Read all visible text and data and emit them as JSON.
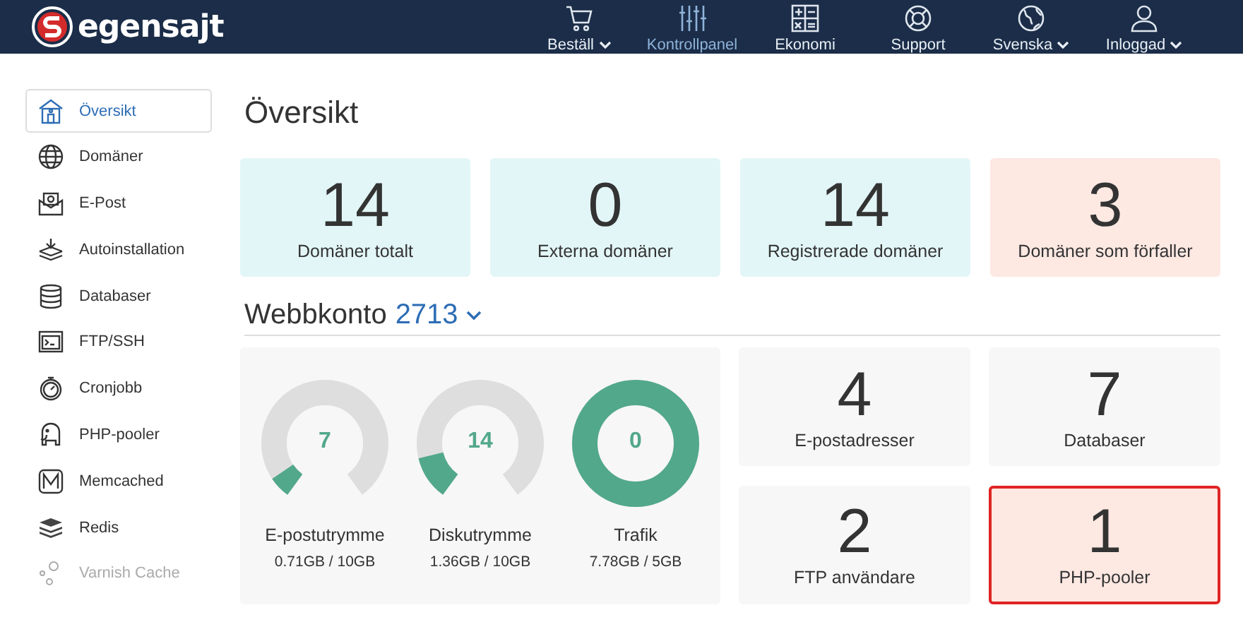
{
  "header": {
    "logo": "egensajt",
    "nav": [
      {
        "label": "Beställ",
        "dropdown": true,
        "selected": false
      },
      {
        "label": "Kontrollpanel",
        "dropdown": false,
        "selected": true
      },
      {
        "label": "Ekonomi",
        "dropdown": false,
        "selected": false
      },
      {
        "label": "Support",
        "dropdown": false,
        "selected": false
      },
      {
        "label": "Svenska",
        "dropdown": true,
        "selected": false
      },
      {
        "label": "Inloggad",
        "dropdown": true,
        "selected": false
      }
    ]
  },
  "sidebar": {
    "items": [
      {
        "label": "Översikt",
        "selected": true,
        "disabled": false
      },
      {
        "label": "Domäner",
        "selected": false,
        "disabled": false
      },
      {
        "label": "E-Post",
        "selected": false,
        "disabled": false
      },
      {
        "label": "Autoinstallation",
        "selected": false,
        "disabled": false
      },
      {
        "label": "Databaser",
        "selected": false,
        "disabled": false
      },
      {
        "label": "FTP/SSH",
        "selected": false,
        "disabled": false
      },
      {
        "label": "Cronjobb",
        "selected": false,
        "disabled": false
      },
      {
        "label": "PHP-pooler",
        "selected": false,
        "disabled": false
      },
      {
        "label": "Memcached",
        "selected": false,
        "disabled": false
      },
      {
        "label": "Redis",
        "selected": false,
        "disabled": false
      },
      {
        "label": "Varnish Cache",
        "selected": false,
        "disabled": true
      }
    ]
  },
  "page_title": "Översikt",
  "stats": [
    {
      "value": "14",
      "label": "Domäner totalt",
      "alert": false
    },
    {
      "value": "0",
      "label": "Externa domäner",
      "alert": false
    },
    {
      "value": "14",
      "label": "Registrerade domäner",
      "alert": false
    },
    {
      "value": "3",
      "label": "Domäner som förfaller",
      "alert": true
    }
  ],
  "account": {
    "label": "Webbkonto",
    "number": "2713"
  },
  "gauges": [
    {
      "value": "7",
      "label": "E-postutrymme",
      "usage": "0.71GB / 10GB",
      "level": 0.07
    },
    {
      "value": "14",
      "label": "Diskutrymme",
      "usage": "1.36GB / 10GB",
      "level": 0.14
    },
    {
      "value": "0",
      "label": "Trafik",
      "usage": "7.78GB / 5GB",
      "level": 1
    }
  ],
  "counters": [
    {
      "value": "4",
      "label": "E-postadresser",
      "alert": false,
      "highlighted": false
    },
    {
      "value": "7",
      "label": "Databaser",
      "alert": false,
      "highlighted": false
    },
    {
      "value": "2",
      "label": "FTP användare",
      "alert": false,
      "highlighted": false
    },
    {
      "value": "1",
      "label": "PHP-pooler",
      "alert": true,
      "highlighted": true
    }
  ]
}
